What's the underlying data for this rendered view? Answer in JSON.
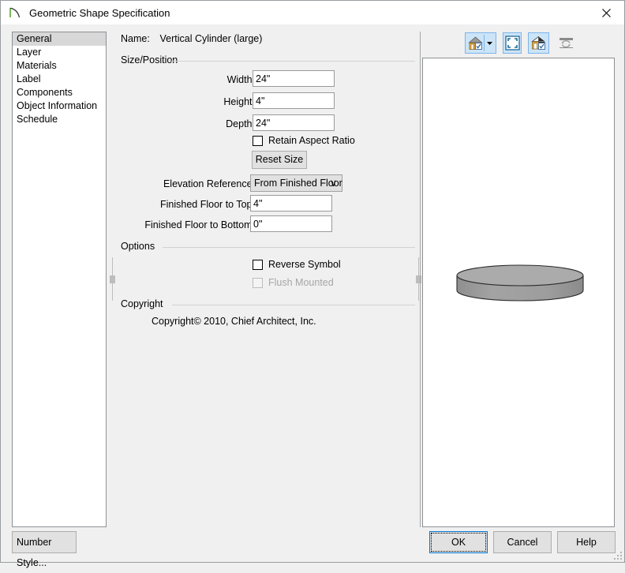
{
  "window": {
    "title": "Geometric Shape Specification",
    "icon": "shape-curve-icon",
    "close_label": "✕"
  },
  "sidebar": {
    "items": [
      {
        "label": "General",
        "selected": true
      },
      {
        "label": "Layer",
        "selected": false
      },
      {
        "label": "Materials",
        "selected": false
      },
      {
        "label": "Label",
        "selected": false
      },
      {
        "label": "Components",
        "selected": false
      },
      {
        "label": "Object Information",
        "selected": false
      },
      {
        "label": "Schedule",
        "selected": false
      }
    ]
  },
  "main": {
    "name_row": {
      "label": "Name:",
      "value": "Vertical Cylinder (large)"
    },
    "size_position": {
      "title": "Size/Position",
      "width": {
        "label": "Width:",
        "value": "24\""
      },
      "height": {
        "label": "Height:",
        "value": "4\""
      },
      "depth": {
        "label": "Depth:",
        "value": "24\""
      },
      "retain_aspect_ratio": {
        "label": "Retain Aspect Ratio",
        "checked": false
      },
      "reset_size_button": "Reset Size",
      "elevation_reference": {
        "label": "Elevation Reference:",
        "value": "From Finished Floor",
        "options": [
          "From Finished Floor"
        ],
        "chevron": "∨"
      },
      "finished_floor_to_top": {
        "label": "Finished Floor to Top:",
        "value": "4\""
      },
      "finished_floor_to_bottom": {
        "label": "Finished Floor to Bottom:",
        "value": "0\""
      }
    },
    "options": {
      "title": "Options",
      "reverse_symbol": {
        "label": "Reverse Symbol",
        "checked": false,
        "disabled": false
      },
      "flush_mounted": {
        "label": "Flush Mounted",
        "checked": false,
        "disabled": true
      }
    },
    "copyright": {
      "title": "Copyright",
      "text": "Copyright© 2010, Chief Architect, Inc."
    }
  },
  "preview": {
    "toolbar": [
      {
        "name": "house-view-icon",
        "active": true
      },
      {
        "name": "chevron-down-icon",
        "active": true
      },
      {
        "name": "fill-window-icon",
        "active": true
      },
      {
        "name": "perspective-view-icon",
        "active": true
      },
      {
        "name": "rotate-icon",
        "active": false
      }
    ],
    "shape": "vertical-cylinder",
    "shape_color": "#9e9e9e",
    "shape_top_color": "#a9a9a9"
  },
  "footer": {
    "number_style": "Number Style...",
    "ok": "OK",
    "cancel": "Cancel",
    "help": "Help"
  },
  "colors": {
    "accent": "#0078d7",
    "toolbar_active": "#cce4f7",
    "dialog_bg": "#f0f0f0",
    "field_bg": "#ffffff"
  }
}
